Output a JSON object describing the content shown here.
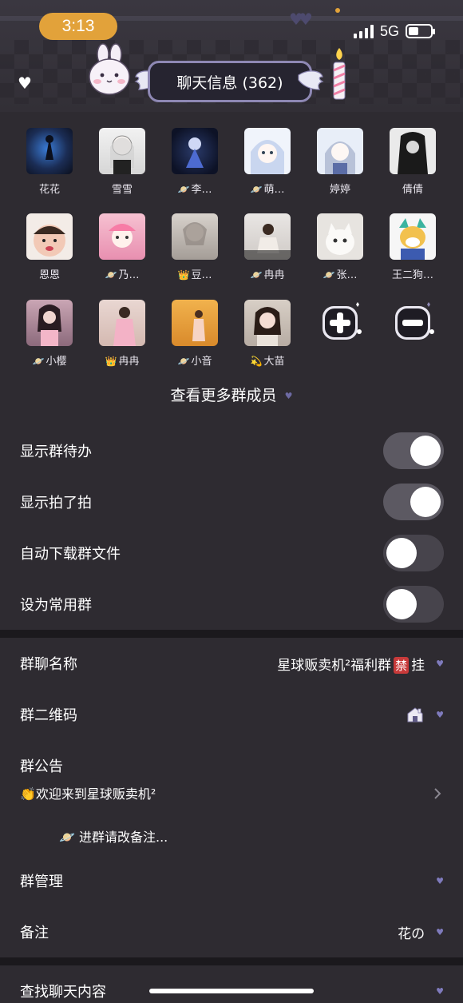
{
  "status_bar": {
    "time": "3:13",
    "network": "5G"
  },
  "header": {
    "title": "聊天信息 (362)"
  },
  "members": [
    {
      "name": "花花",
      "badge": ""
    },
    {
      "name": "雪雪",
      "badge": ""
    },
    {
      "name": "李…",
      "badge": "🪐"
    },
    {
      "name": "萌…",
      "badge": "🪐"
    },
    {
      "name": "婷婷",
      "badge": ""
    },
    {
      "name": "倩倩",
      "badge": ""
    },
    {
      "name": "恩恩",
      "badge": ""
    },
    {
      "name": "乃…",
      "badge": "🪐"
    },
    {
      "name": "豆…",
      "badge": "👑"
    },
    {
      "name": "冉冉",
      "badge": "🪐"
    },
    {
      "name": "张…",
      "badge": "🪐"
    },
    {
      "name": "王二狗…",
      "badge": ""
    },
    {
      "name": "小樱",
      "badge": "🪐"
    },
    {
      "name": "冉冉",
      "badge": "👑"
    },
    {
      "name": "小音",
      "badge": "🪐"
    },
    {
      "name": "大苗",
      "badge": "💫"
    }
  ],
  "more_members_label": "查看更多群成员",
  "toggles": [
    {
      "label": "显示群待办",
      "on": true
    },
    {
      "label": "显示拍了拍",
      "on": true
    },
    {
      "label": "自动下载群文件",
      "on": false
    },
    {
      "label": "设为常用群",
      "on": false
    }
  ],
  "group_name": {
    "label": "群聊名称",
    "value_prefix": "星球贩卖机²福利群",
    "value_ban": "禁",
    "value_suffix": "挂"
  },
  "qr_code": {
    "label": "群二维码"
  },
  "notice": {
    "label": "群公告",
    "line1": "👏欢迎来到星球贩卖机²",
    "line2": "🪐 进群请改备注..."
  },
  "management": {
    "label": "群管理"
  },
  "remark": {
    "label": "备注",
    "value": "花の"
  },
  "search_chat": {
    "label": "查找聊天内容"
  },
  "colors": {
    "background": "#2e2b31",
    "time_pill": "#e2a23a",
    "accent_heart": "#7f7bbd",
    "ban": "#c83a3a"
  }
}
